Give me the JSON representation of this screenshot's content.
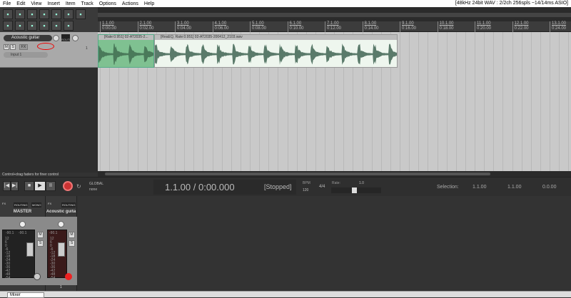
{
  "menu": [
    "File",
    "Edit",
    "View",
    "Insert",
    "Item",
    "Track",
    "Options",
    "Actions",
    "Help"
  ],
  "status": "[48kHz 24bit WAV : 2/2ch 256spls ~14/14ms ASIO]",
  "ruler": [
    {
      "bar": "1.1.00",
      "time": "0:00.00"
    },
    {
      "bar": "2.1.00",
      "time": "0:02.00"
    },
    {
      "bar": "3.1.00",
      "time": "0:04.00"
    },
    {
      "bar": "4.1.00",
      "time": "0:06.00"
    },
    {
      "bar": "5.1.00",
      "time": "0:08.00"
    },
    {
      "bar": "6.1.00",
      "time": "0:10.00"
    },
    {
      "bar": "7.1.00",
      "time": "0:12.00"
    },
    {
      "bar": "8.1.00",
      "time": "0:14.00"
    },
    {
      "bar": "9.1.00",
      "time": "0:16.00"
    },
    {
      "bar": "10.1.00",
      "time": "0:18.00"
    },
    {
      "bar": "11.1.00",
      "time": "0:20.00"
    },
    {
      "bar": "12.1.00",
      "time": "0:22.00"
    },
    {
      "bar": "13.1.00",
      "time": "0:24.00"
    }
  ],
  "track": {
    "name": "Acoustic guitar",
    "mute": "M",
    "solo": "S",
    "fx": "FX",
    "input": "Input 1",
    "number": "1",
    "route": "ROUTE"
  },
  "items": [
    {
      "label": "[Rate:0.951] 02-AT2035-2..."
    },
    {
      "label": "[ReaEQ, Rate:0.951] 02-AT2035-200412_2103.wav"
    }
  ],
  "hint": "Control+drag faders for finer control",
  "transport": {
    "time": "1.1.00 / 0:00.000",
    "state": "[Stopped]",
    "bpm_label": "BPM",
    "bpm": "120",
    "timesig": "4/4",
    "rate_label": "Rate:",
    "rate": "1.0",
    "selection_label": "Selection:",
    "sel_start": "1.1.00",
    "sel_end": "1.1.00",
    "sel_len": "0.0.00",
    "global": "GLOBAL",
    "none": "none"
  },
  "mixer": {
    "master": {
      "name": "MASTER",
      "vol": "-90.1",
      "peak": "-90.1",
      "fx": "FX",
      "routing": "ROUTING",
      "mono": "MONO",
      "mute": "M",
      "solo": "S"
    },
    "track": {
      "name": "Acoustic guita",
      "vol": "-90.1",
      "fx": "FX",
      "routing": "ROUTING",
      "mute": "M",
      "solo": "S",
      "number": "1"
    },
    "scale": [
      "12",
      "6",
      "0",
      "-6",
      "-12",
      "-18",
      "-24",
      "-30",
      "-36",
      "-42",
      "-48",
      "-54"
    ]
  },
  "bottom_tab": "Mixer",
  "colors": {
    "item_selected": "#7fc191",
    "item": "#eef6ee",
    "record": "#e33"
  }
}
